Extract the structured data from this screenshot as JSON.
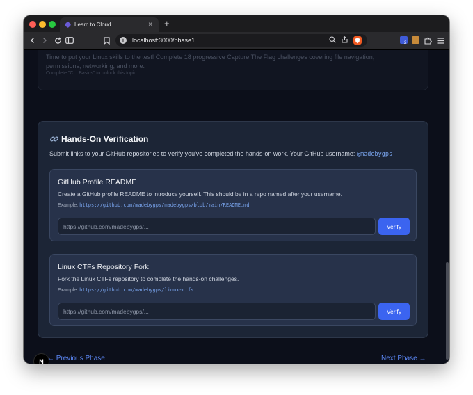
{
  "browser": {
    "tab_title": "Learn to Cloud",
    "tab_close": "×",
    "new_tab": "+",
    "url": "localhost:3000/phase1",
    "extension_badge_count": "2",
    "brave_icon": "brave-shield-icon"
  },
  "previous_topic": {
    "description": "Time to put your Linux skills to the test! Complete 18 progressive Capture The Flag challenges covering file navigation, permissions, networking, and more.",
    "locked_note": "Complete \"CLI Basics\" to unlock this topic"
  },
  "verification": {
    "title": "Hands-On Verification",
    "intro": "Submit links to your GitHub repositories to verify you've completed the hands-on work. Your GitHub username:",
    "username": "@madebygps",
    "tasks": [
      {
        "title": "GitHub Profile README",
        "description": "Create a GitHub profile README to introduce yourself. This should be in a repo named after your username.",
        "example_label": "Example:",
        "example_url": "https://github.com/madebygps/madebygps/blob/main/README.md",
        "placeholder": "https://github.com/madebygps/...",
        "value": "",
        "button": "Verify"
      },
      {
        "title": "Linux CTFs Repository Fork",
        "description": "Fork the Linux CTFs repository to complete the hands-on challenges.",
        "example_label": "Example:",
        "example_url": "https://github.com/madebygps/linux-ctfs",
        "placeholder": "https://github.com/madebygps/...",
        "value": "",
        "button": "Verify"
      }
    ]
  },
  "navigation": {
    "previous": "← Previous Phase",
    "next": "Next Phase →"
  },
  "dev_badge": "N",
  "colors": {
    "page_background": "#0c0f1a",
    "card_background": "#1c2536",
    "accent": "#3b64f0",
    "link": "#5b86f3"
  }
}
